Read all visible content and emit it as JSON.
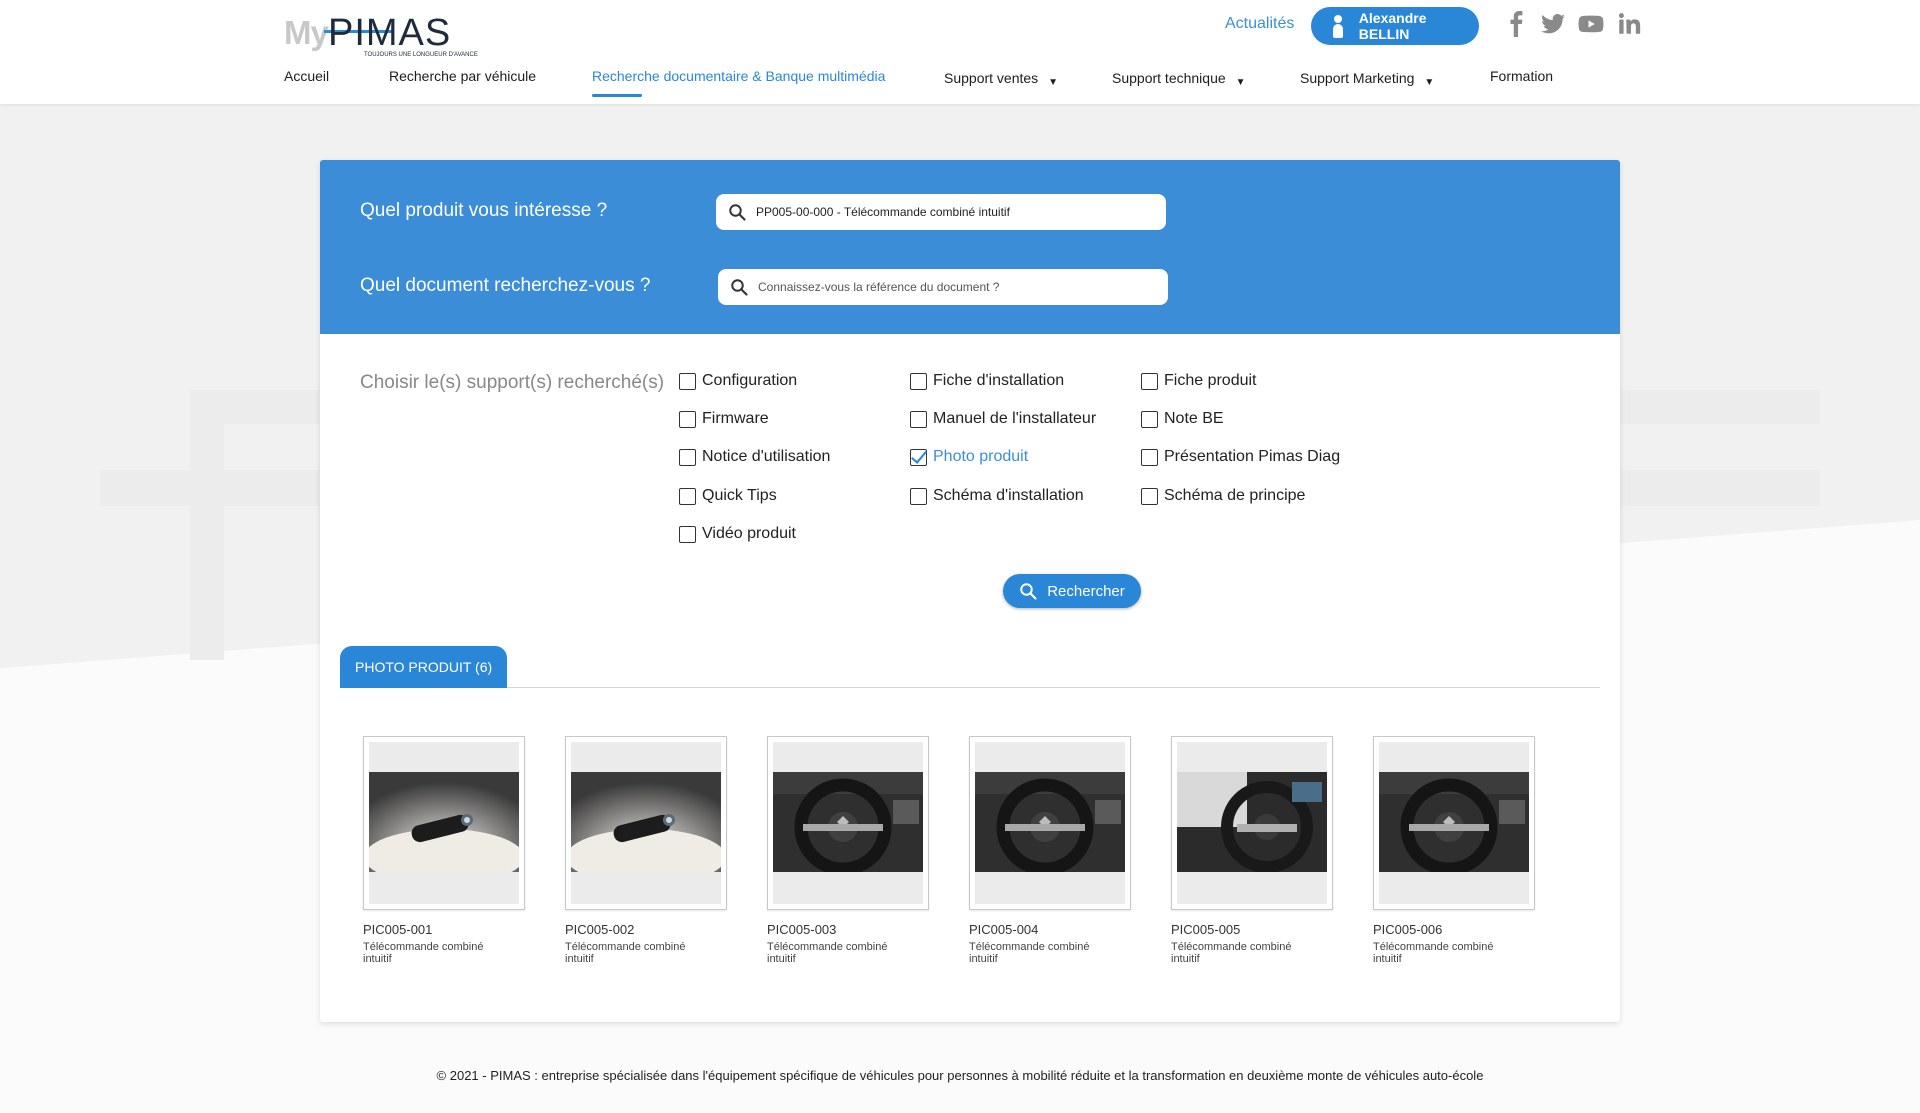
{
  "header": {
    "logo": {
      "prefix": "My",
      "name": "PIMAS",
      "tagline": "TOUJOURS UNE LONGUEUR D'AVANCE"
    },
    "actualites": "Actualités",
    "user_name": "Alexandre BELLIN",
    "social": [
      "facebook-icon",
      "twitter-icon",
      "youtube-icon",
      "linkedin-icon"
    ]
  },
  "nav": {
    "items": [
      {
        "label": "Accueil",
        "dropdown": false
      },
      {
        "label": "Recherche par véhicule",
        "dropdown": false
      },
      {
        "label": "Recherche documentaire & Banque multimédia",
        "dropdown": false,
        "active": true
      },
      {
        "label": "Support ventes",
        "dropdown": true
      },
      {
        "label": "Support technique",
        "dropdown": true
      },
      {
        "label": "Support Marketing",
        "dropdown": true
      },
      {
        "label": "Formation",
        "dropdown": false
      }
    ]
  },
  "search": {
    "product_label": "Quel produit vous intéresse ?",
    "product_value": "PP005-00-000 - Télécommande combiné intuitif",
    "document_label": "Quel document recherchez-vous ?",
    "document_placeholder": "Connaissez-vous la référence du document ?"
  },
  "filters": {
    "label": "Choisir le(s) support(s) recherché(s)",
    "options": [
      {
        "label": "Configuration",
        "checked": false
      },
      {
        "label": "Fiche d'installation",
        "checked": false
      },
      {
        "label": "Fiche produit",
        "checked": false
      },
      {
        "label": "Firmware",
        "checked": false
      },
      {
        "label": "Manuel de l'installateur",
        "checked": false
      },
      {
        "label": "Note BE",
        "checked": false
      },
      {
        "label": "Notice d'utilisation",
        "checked": false
      },
      {
        "label": "Photo produit",
        "checked": true
      },
      {
        "label": "Présentation Pimas Diag",
        "checked": false
      },
      {
        "label": "Quick Tips",
        "checked": false
      },
      {
        "label": "Schéma d'installation",
        "checked": false
      },
      {
        "label": "Schéma de principe",
        "checked": false
      },
      {
        "label": "Vidéo produit",
        "checked": false
      }
    ],
    "search_button": "Rechercher"
  },
  "results": {
    "tab_label": "PHOTO PRODUIT (6)",
    "items": [
      {
        "ref": "PIC005-001",
        "desc": "Télécommande combiné intuitif",
        "kind": "remote"
      },
      {
        "ref": "PIC005-002",
        "desc": "Télécommande combiné intuitif",
        "kind": "remote"
      },
      {
        "ref": "PIC005-003",
        "desc": "Télécommande combiné intuitif",
        "kind": "wheel"
      },
      {
        "ref": "PIC005-004",
        "desc": "Télécommande combiné intuitif",
        "kind": "wheel"
      },
      {
        "ref": "PIC005-005",
        "desc": "Télécommande combiné intuitif",
        "kind": "wheel-side"
      },
      {
        "ref": "PIC005-006",
        "desc": "Télécommande combiné intuitif",
        "kind": "wheel"
      }
    ]
  },
  "footer": "© 2021 - PIMAS : entreprise spécialisée dans l'équipement spécifique de véhicules pour personnes à mobilité réduite et la transformation en deuxième monte de véhicules auto-école",
  "colors": {
    "accent": "#2a87d8",
    "band": "#3a8dd6",
    "background": "#f1f1f1"
  }
}
